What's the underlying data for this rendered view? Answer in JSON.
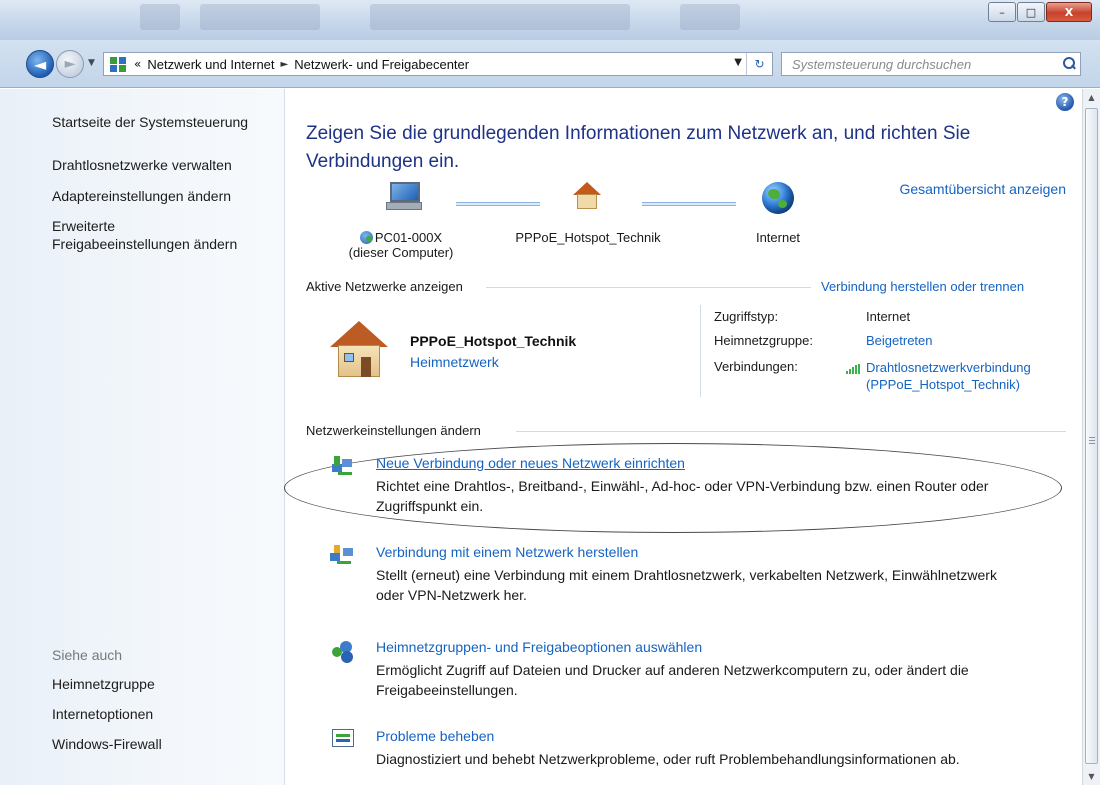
{
  "window": {
    "minimize_label": "–",
    "maximize_label": "□",
    "close_label": "X"
  },
  "navigation": {
    "back_label": "◄",
    "forward_label": "►",
    "dropdown_label": "▼",
    "breadcrumb_lead": "«",
    "breadcrumbs": [
      "Netzwerk und Internet",
      "Netzwerk- und Freigabecenter"
    ],
    "breadcrumb_sep": "►",
    "address_dropdown": "▼",
    "refresh_label": "↻",
    "search_placeholder": "Systemsteuerung durchsuchen"
  },
  "sidebar": {
    "links": [
      "Startseite der Systemsteuerung",
      "Drahtlosnetzwerke verwalten",
      "Adaptereinstellungen ändern",
      "Erweiterte",
      "Freigabeeinstellungen ändern"
    ],
    "see_also_label": "Siehe auch",
    "see_also": [
      "Heimnetzgruppe",
      "Internetoptionen",
      "Windows-Firewall"
    ]
  },
  "main": {
    "help_label": "?",
    "heading_line1": "Zeigen Sie die grundlegenden Informationen zum Netzwerk an, und richten Sie",
    "heading_line2": "Verbindungen ein.",
    "full_map_link": "Gesamtübersicht anzeigen",
    "map": {
      "computer_name": "PC01-000X",
      "computer_caption": "(dieser Computer)",
      "network_name": "PPPoE_Hotspot_Technik",
      "internet_label": "Internet"
    },
    "active_networks": {
      "heading": "Aktive Netzwerke anzeigen",
      "connect_link": "Verbindung herstellen oder trennen",
      "network_name": "PPPoE_Hotspot_Technik",
      "network_type": "Heimnetzwerk",
      "access_type_label": "Zugriffstyp:",
      "access_type_value": "Internet",
      "homegroup_label": "Heimnetzgruppe:",
      "homegroup_value": "Beigetreten",
      "connections_label": "Verbindungen:",
      "connection_line1": "Drahtlosnetzwerkverbindung",
      "connection_line2": "(PPPoE_Hotspot_Technik)"
    },
    "change_settings": {
      "heading": "Netzwerkeinstellungen ändern",
      "tasks": [
        {
          "title": "Neue Verbindung oder neues Netzwerk einrichten",
          "desc_line1": "Richtet eine Drahtlos-, Breitband-, Einwähl-, Ad-hoc- oder VPN-Verbindung bzw. einen Router oder",
          "desc_line2": "Zugriffspunkt ein."
        },
        {
          "title": "Verbindung mit einem Netzwerk herstellen",
          "desc_line1": "Stellt (erneut) eine Verbindung mit einem Drahtlosnetzwerk, verkabelten Netzwerk, Einwählnetzwerk",
          "desc_line2": "oder VPN-Netzwerk her."
        },
        {
          "title": "Heimnetzgruppen- und Freigabeoptionen auswählen",
          "desc_line1": "Ermöglicht Zugriff auf Dateien und Drucker auf anderen Netzwerkcomputern zu, oder ändert die",
          "desc_line2": "Freigabeeinstellungen."
        },
        {
          "title": "Probleme beheben",
          "desc_line1": "Diagnostiziert und behebt Netzwerkprobleme, oder ruft Problembehandlungsinformationen ab.",
          "desc_line2": ""
        }
      ]
    }
  },
  "scrollbar": {
    "up": "▲",
    "down": "▼"
  },
  "colors": {
    "link": "#1563c3",
    "heading": "#1e3287",
    "signal": "#3bb34a"
  },
  "icons": [
    "back-icon",
    "forward-icon",
    "control-panel-icon",
    "search-icon",
    "help-icon",
    "computer-icon",
    "house-icon",
    "globe-icon",
    "signal-icon",
    "new-connection-icon",
    "connect-network-icon",
    "homegroup-icon",
    "troubleshoot-icon"
  ]
}
